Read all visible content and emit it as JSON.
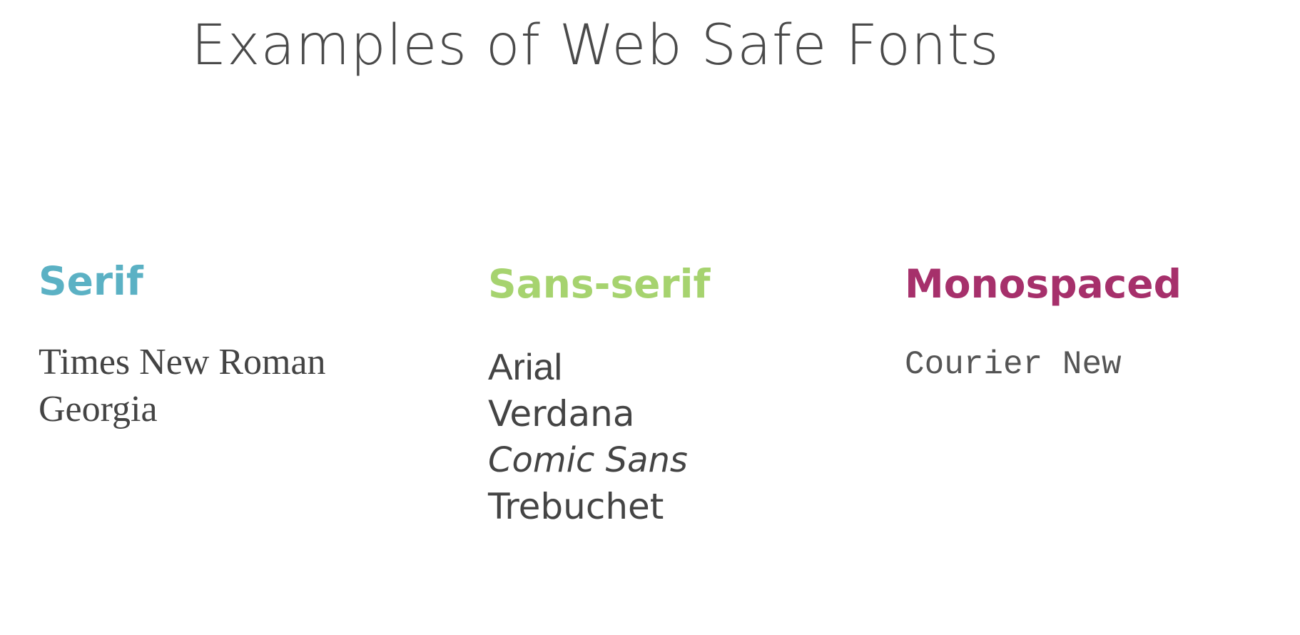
{
  "title": "Examples of Web Safe Fonts",
  "colors": {
    "serif_heading": "#5bb1c4",
    "sans_heading": "#a6d36f",
    "mono_heading": "#a6306b",
    "text": "#444444"
  },
  "columns": [
    {
      "heading": "Serif",
      "fonts": [
        "Times New Roman",
        "Georgia"
      ]
    },
    {
      "heading": "Sans-serif",
      "fonts": [
        "Arial",
        "Verdana",
        "Comic Sans",
        "Trebuchet"
      ]
    },
    {
      "heading": "Monospaced",
      "fonts": [
        "Courier New"
      ]
    }
  ]
}
